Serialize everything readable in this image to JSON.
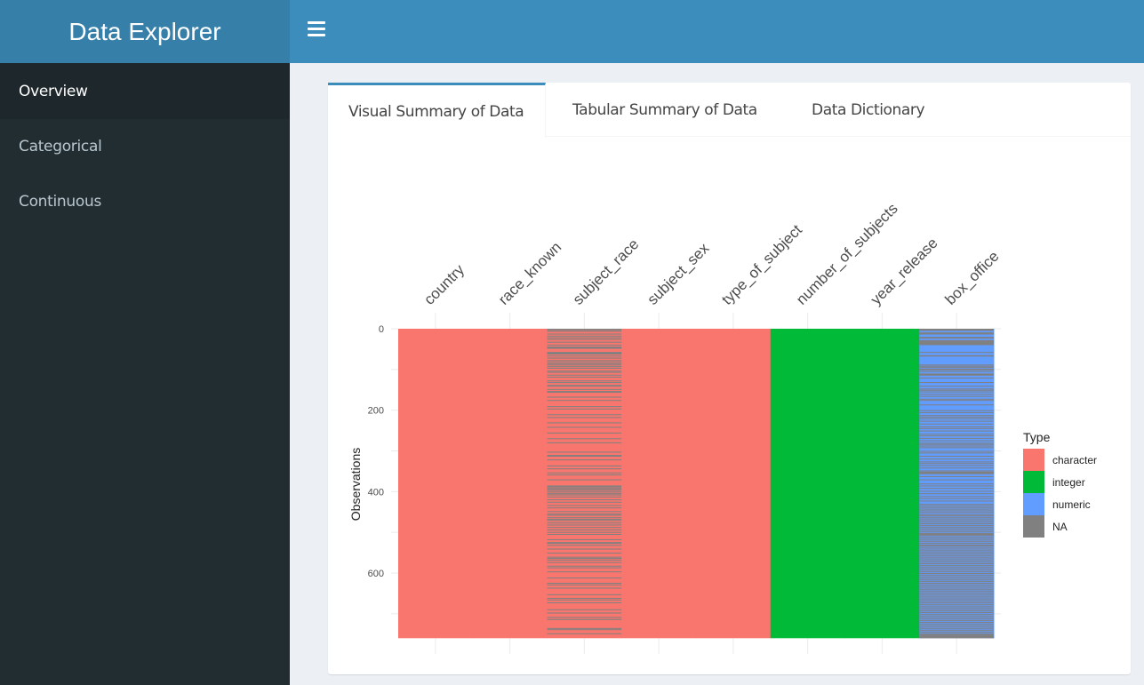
{
  "app": {
    "title": "Data Explorer"
  },
  "navbar": {
    "toggle_icon": "hamburger-menu-icon"
  },
  "sidebar": {
    "items": [
      {
        "label": "Overview",
        "active": true
      },
      {
        "label": "Categorical",
        "active": false
      },
      {
        "label": "Continuous",
        "active": false
      }
    ]
  },
  "tabs": [
    {
      "label": "Visual Summary of Data",
      "active": true
    },
    {
      "label": "Tabular Summary of Data",
      "active": false
    },
    {
      "label": "Data Dictionary",
      "active": false
    }
  ],
  "colors": {
    "header": "#3c8dbc",
    "logo": "#367fa9",
    "sidebar": "#222d32",
    "sidebar_active": "#1e282c",
    "content_bg": "#ecf0f5"
  },
  "chart_data": {
    "type": "heatmap",
    "title": "",
    "xlabel": "",
    "ylabel": "Observations",
    "n_observations": 760,
    "ylim": [
      0,
      760
    ],
    "y_ticks": [
      0,
      200,
      400,
      600
    ],
    "y_minor_ticks": [
      100,
      300,
      500,
      700
    ],
    "columns": [
      {
        "name": "country",
        "type": "character"
      },
      {
        "name": "race_known",
        "type": "character"
      },
      {
        "name": "subject_race",
        "type": "character"
      },
      {
        "name": "subject_sex",
        "type": "character"
      },
      {
        "name": "type_of_subject",
        "type": "character"
      },
      {
        "name": "number_of_subjects",
        "type": "integer"
      },
      {
        "name": "year_release",
        "type": "integer"
      },
      {
        "name": "box_office",
        "type": "numeric"
      }
    ],
    "missing_rows": {
      "subject_race": [
        0,
        3,
        5,
        12,
        17,
        21,
        25,
        32,
        39,
        44,
        45,
        46,
        47,
        57,
        58,
        60,
        61,
        66,
        71,
        77,
        81,
        85,
        88,
        92,
        96,
        103,
        106,
        113,
        118,
        127,
        131,
        138,
        140,
        148,
        153,
        154,
        155,
        167,
        175,
        190,
        196,
        210,
        217,
        230,
        241,
        255,
        269,
        279,
        302,
        310,
        312,
        321,
        336,
        343,
        353,
        358,
        370,
        385,
        387,
        390,
        393,
        396,
        400,
        404,
        407,
        412,
        419,
        425,
        433,
        439,
        448,
        454,
        457,
        463,
        467,
        470,
        476,
        481,
        487,
        493,
        499,
        504,
        517,
        524,
        526,
        531,
        540,
        550,
        560,
        563,
        567,
        573,
        582,
        586,
        596,
        611,
        624,
        628,
        636,
        652,
        661,
        665,
        672,
        689,
        697,
        708,
        713,
        735,
        738,
        748
      ],
      "box_office": [
        0,
        1,
        2,
        3,
        9,
        10,
        11,
        12,
        20,
        21,
        22,
        28,
        29,
        30,
        31,
        32,
        33,
        34,
        35,
        36,
        37,
        38,
        57,
        65,
        66,
        88,
        91,
        94,
        98,
        100,
        104,
        110,
        111,
        112,
        113,
        120,
        131,
        140,
        147,
        150,
        154,
        160,
        165,
        172,
        175,
        186,
        200,
        205,
        212,
        216,
        220,
        226,
        233,
        240,
        244,
        250,
        258,
        262,
        268,
        274,
        280,
        283,
        287,
        291,
        300,
        304,
        312,
        319,
        326,
        330,
        335,
        341,
        348,
        351,
        352,
        353,
        354,
        355,
        362,
        370,
        380,
        385,
        391,
        398,
        404,
        411,
        416,
        422,
        430,
        434,
        438,
        442,
        446,
        450,
        455,
        458,
        462,
        466,
        470,
        474,
        478,
        482,
        486,
        490,
        494,
        498,
        502,
        504,
        506,
        510,
        514,
        518,
        522,
        526,
        530,
        532,
        536,
        540,
        544,
        548,
        552,
        556,
        560,
        564,
        568,
        572,
        576,
        580,
        584,
        588,
        592,
        596,
        600,
        604,
        608,
        612,
        616,
        620,
        624,
        628,
        632,
        636,
        640,
        644,
        648,
        652,
        656,
        660,
        664,
        668,
        672,
        676,
        680,
        684,
        688,
        692,
        696,
        700,
        704,
        708,
        712,
        716,
        720,
        724,
        728,
        732,
        736,
        740,
        744,
        748,
        750,
        752,
        754,
        756,
        758
      ]
    },
    "legend": {
      "title": "Type",
      "position": "right",
      "entries": [
        {
          "label": "character",
          "color": "#F8766D"
        },
        {
          "label": "integer",
          "color": "#00BA38"
        },
        {
          "label": "numeric",
          "color": "#619CFF"
        },
        {
          "label": "NA",
          "color": "#808080"
        }
      ]
    },
    "grid": true
  }
}
